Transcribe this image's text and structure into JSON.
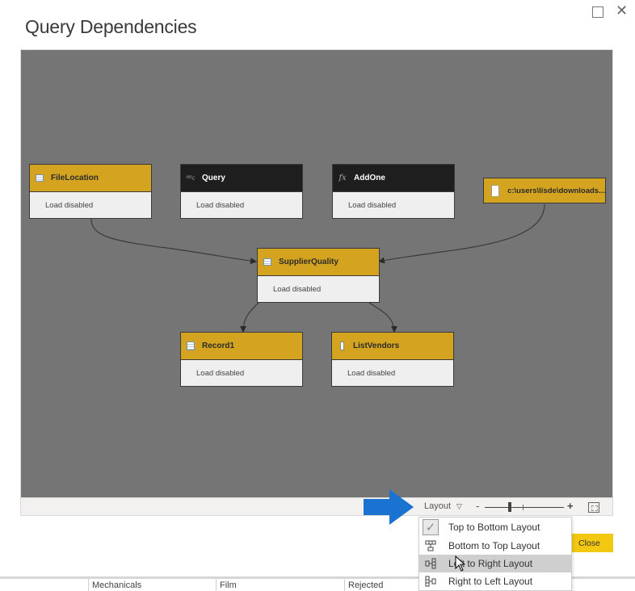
{
  "window": {
    "maximize_icon": "maximize-icon",
    "close_glyph": "✕"
  },
  "dialog": {
    "title": "Query Dependencies"
  },
  "diagram": {
    "nodes": [
      {
        "id": "filelocation",
        "name": "FileLocation",
        "status": "Load disabled",
        "style": "gold",
        "icon": "table-icon"
      },
      {
        "id": "query",
        "name": "Query",
        "status": "Load disabled",
        "style": "dark",
        "icon": "abc-text-icon"
      },
      {
        "id": "addone",
        "name": "AddOne",
        "status": "Load disabled",
        "style": "dark",
        "icon": "function-icon"
      },
      {
        "id": "file-source",
        "name": "c:\\users\\lisde\\downloads...",
        "style": "gold",
        "icon": "file-icon"
      },
      {
        "id": "supplierquality",
        "name": "SupplierQuality",
        "status": "Load disabled",
        "style": "gold",
        "icon": "table-icon"
      },
      {
        "id": "record1",
        "name": "Record1",
        "status": "Load disabled",
        "style": "gold",
        "icon": "record-icon"
      },
      {
        "id": "listvendors",
        "name": "ListVendors",
        "status": "Load disabled",
        "style": "gold",
        "icon": "list-icon"
      }
    ],
    "edges": [
      {
        "from": "filelocation",
        "to": "supplierquality"
      },
      {
        "from": "file-source",
        "to": "supplierquality"
      },
      {
        "from": "supplierquality",
        "to": "record1"
      },
      {
        "from": "supplierquality",
        "to": "listvendors"
      }
    ],
    "colors": {
      "canvas": "#757575",
      "node_gold": "#d4a420",
      "node_dark": "#1e1e1e",
      "node_body": "#efefef"
    }
  },
  "toolbar": {
    "layout_label": "Layout",
    "zoom_minus": "-",
    "zoom_plus": "+",
    "zoom_level_fraction": 0.32
  },
  "layout_menu": {
    "items": [
      {
        "label": "Top to Bottom Layout",
        "icon": "checkmark-icon",
        "checked": true
      },
      {
        "label": "Bottom to Top Layout",
        "icon": "bottom-to-top-icon",
        "checked": false
      },
      {
        "label": "Left to Right Layout",
        "icon": "left-to-right-icon",
        "checked": false,
        "hovered": true
      },
      {
        "label": "Right to Left Layout",
        "icon": "right-to-left-icon",
        "checked": false
      }
    ]
  },
  "close_button": {
    "label": "Close",
    "color": "#f2c811"
  },
  "annotation": {
    "arrow_color": "#1a73d0"
  },
  "background_table": {
    "columns": [
      "",
      "Mechanicals",
      "Film",
      "Rejected"
    ]
  }
}
